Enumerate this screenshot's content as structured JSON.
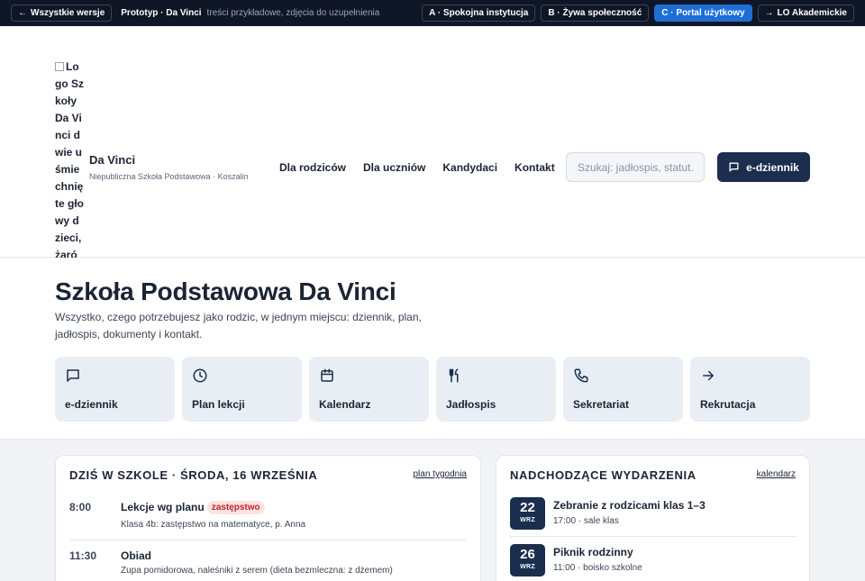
{
  "proto_bar": {
    "back_label": "Wszystkie wersje",
    "title": "Prototyp · Da Vinci",
    "subtitle": "treści przykładowe, zdjęcia do uzupełnienia",
    "variants": [
      {
        "label": "A · Spokojna instytucja",
        "active": false
      },
      {
        "label": "B · Żywa społeczność",
        "active": false
      },
      {
        "label": "C · Portal użytkowy",
        "active": true
      }
    ],
    "lo_link": "LO Akademickie"
  },
  "header": {
    "logo_alt": "Logo Szkoły Da Vinci dwie uśmiechnięte głowy dzieci, żarówka, lupa i komputer",
    "brand_name": "Da Vinci",
    "brand_sub": "Niepubliczna Szkoła Podstawowa · Koszalin",
    "nav": [
      "Dla rodziców",
      "Dla uczniów",
      "Kandydaci",
      "Kontakt"
    ],
    "search_placeholder": "Szukaj: jadłospis, statut…",
    "ediary_label": "e-dziennik"
  },
  "hero": {
    "title": "Szkoła Podstawowa Da Vinci",
    "description": "Wszystko, czego potrzebujesz jako rodzic, w jednym miejscu: dziennik, plan, jadłospis, dokumenty i kontakt.",
    "tiles": [
      {
        "icon": "message-square-icon",
        "label": "e-dziennik"
      },
      {
        "icon": "clock-icon",
        "label": "Plan lekcji"
      },
      {
        "icon": "calendar-icon",
        "label": "Kalendarz"
      },
      {
        "icon": "utensils-icon",
        "label": "Jadłospis"
      },
      {
        "icon": "phone-icon",
        "label": "Sekretariat"
      },
      {
        "icon": "arrow-right-icon",
        "label": "Rekrutacja"
      }
    ]
  },
  "today": {
    "heading": "DZIŚ W SZKOLE · ŚRODA, 16 WRZEŚNIA",
    "link": "plan tygodnia",
    "items": [
      {
        "time": "8:00",
        "title": "Lekcje wg planu",
        "badge": "zastępstwo",
        "desc": "Klasa 4b: zastępstwo na matematyce, p. Anna"
      },
      {
        "time": "11:30",
        "title": "Obiad",
        "desc": "Zupa pomidorowa, naleśniki z serem (dieta bezmleczna: z dżemem)"
      }
    ]
  },
  "events": {
    "heading": "NADCHODZĄCE WYDARZENIA",
    "link": "kalendarz",
    "items": [
      {
        "day": "22",
        "month": "WRZ",
        "title": "Zebranie z rodzicami klas 1–3",
        "meta": "17:00 · sale klas"
      },
      {
        "day": "26",
        "month": "WRZ",
        "title": "Piknik rodzinny",
        "meta": "11:00 · boisko szkolne"
      }
    ]
  },
  "colors": {
    "navy": "#1b2e4e",
    "accent_blue": "#1d6fd6",
    "tile_bg": "#e9eef5",
    "badge_red": "#c0262b"
  }
}
